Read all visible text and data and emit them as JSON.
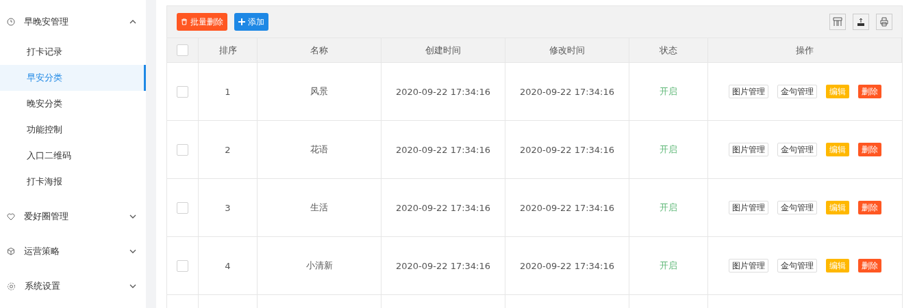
{
  "sidebar": {
    "groups": [
      {
        "label": "早晚安管理",
        "expanded": true,
        "items": [
          {
            "label": "打卡记录",
            "selected": false
          },
          {
            "label": "早安分类",
            "selected": true
          },
          {
            "label": "晚安分类",
            "selected": false
          },
          {
            "label": "功能控制",
            "selected": false
          },
          {
            "label": "入口二维码",
            "selected": false
          },
          {
            "label": "打卡海报",
            "selected": false
          }
        ]
      },
      {
        "label": "爱好圈管理",
        "expanded": false
      },
      {
        "label": "运营策略",
        "expanded": false
      },
      {
        "label": "系统设置",
        "expanded": false
      }
    ]
  },
  "toolbar": {
    "batch_delete": "批量删除",
    "add": "添加"
  },
  "table": {
    "select_all_checked": false,
    "columns": [
      "排序",
      "名称",
      "创建时间",
      "修改时间",
      "状态",
      "操作"
    ],
    "rows": [
      {
        "checked": false,
        "order": "1",
        "name": "风景",
        "created": "2020-09-22 17:34:16",
        "modified": "2020-09-22 17:34:16",
        "status": "开启",
        "actions": [
          "图片管理",
          "金句管理",
          "编辑",
          "删除"
        ]
      },
      {
        "checked": false,
        "order": "2",
        "name": "花语",
        "created": "2020-09-22 17:34:16",
        "modified": "2020-09-22 17:34:16",
        "status": "开启",
        "actions": [
          "图片管理",
          "金句管理",
          "编辑",
          "删除"
        ]
      },
      {
        "checked": false,
        "order": "3",
        "name": "生活",
        "created": "2020-09-22 17:34:16",
        "modified": "2020-09-22 17:34:16",
        "status": "开启",
        "actions": [
          "图片管理",
          "金句管理",
          "编辑",
          "删除"
        ]
      },
      {
        "checked": false,
        "order": "4",
        "name": "小清新",
        "created": "2020-09-22 17:34:16",
        "modified": "2020-09-22 17:34:16",
        "status": "开启",
        "actions": [
          "图片管理",
          "金句管理",
          "编辑",
          "删除"
        ]
      }
    ]
  }
}
